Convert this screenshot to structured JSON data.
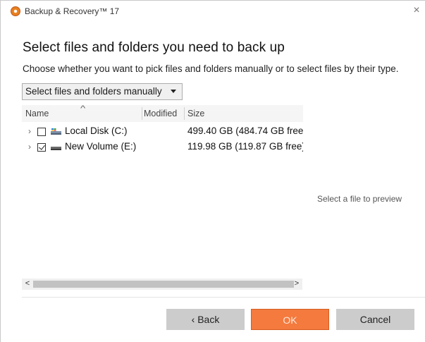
{
  "window": {
    "title": "Backup & Recovery™ 17",
    "close_glyph": "×"
  },
  "page": {
    "heading": "Select files and folders you need to back up",
    "subheading": "Choose whether you want to pick files and folders manually or to select files by their type."
  },
  "selection_mode": {
    "selected": "Select files and folders manually"
  },
  "tree": {
    "columns": {
      "name": "Name",
      "modified": "Modified",
      "size": "Size"
    },
    "rows": [
      {
        "label": "Local Disk (C:)",
        "size": "499.40 GB (484.74 GB free)",
        "checked": false,
        "icon": "system-drive-icon"
      },
      {
        "label": "New Volume (E:)",
        "size": "119.98 GB (119.87 GB free)",
        "checked": true,
        "icon": "drive-icon"
      }
    ]
  },
  "preview": {
    "placeholder": "Select a file to preview"
  },
  "buttons": {
    "back": "‹ Back",
    "ok": "OK",
    "cancel": "Cancel"
  },
  "colors": {
    "accent": "#f47a3e",
    "button_gray": "#cccccc"
  }
}
